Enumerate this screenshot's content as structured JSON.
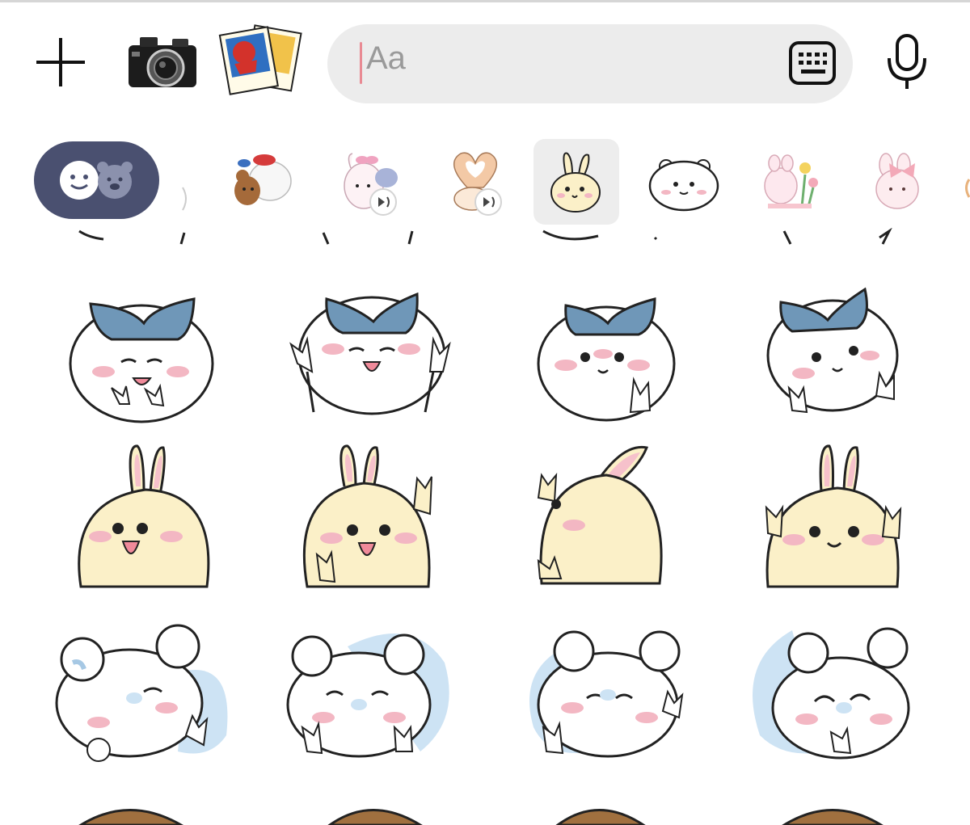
{
  "toolbar": {
    "add_icon": "plus-icon",
    "camera_icon": "camera-icon",
    "gallery_icon": "photo-gallery-icon",
    "mic_icon": "microphone-icon"
  },
  "composer": {
    "placeholder": "Aa",
    "keyboard_icon": "keyboard-icon"
  },
  "sticker_tabs": [
    {
      "name": "emoji-tab",
      "selected": false
    },
    {
      "name": "bear-dog-pack",
      "selected": false
    },
    {
      "name": "pink-bunny-voice-pack",
      "has_sound": true,
      "selected": false
    },
    {
      "name": "heart-hands-voice-pack",
      "has_sound": true,
      "selected": false
    },
    {
      "name": "usagi-pack",
      "selected": true
    },
    {
      "name": "chiikawa-face-pack",
      "selected": false
    },
    {
      "name": "flower-bunny-pack",
      "selected": false
    },
    {
      "name": "ribbon-bunny-pack",
      "selected": false
    }
  ],
  "colors": {
    "emoji_tab_bg": "#4a5070",
    "input_bg": "#ececec",
    "caret": "#e98a93",
    "ribbon_blue": "#6f97b8",
    "usagi_yellow": "#fbf0c8",
    "blush": "#f3b7c3",
    "hedgehog_blue": "#cde3f4"
  },
  "sticker_rows": [
    {
      "character": "ribbon-chiikawa",
      "count": 4
    },
    {
      "character": "usagi",
      "count": 4
    },
    {
      "character": "momonga-hedgehog",
      "count": 4
    }
  ]
}
